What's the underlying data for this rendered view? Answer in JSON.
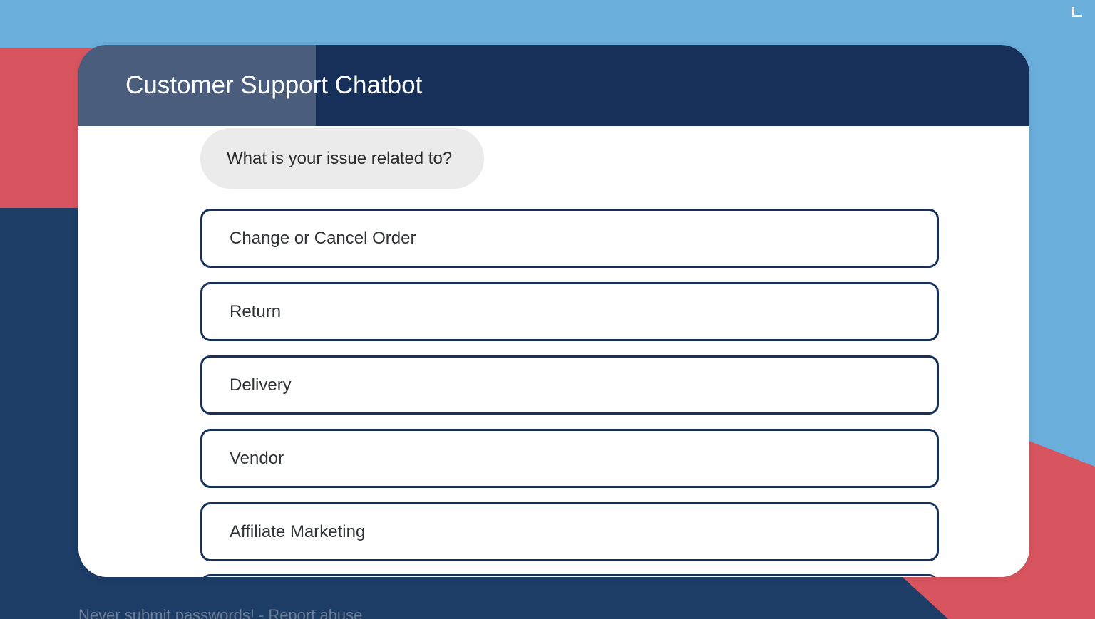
{
  "background": {
    "sky_color": "#6aaedc",
    "navy_color": "#1d3c66",
    "red_color": "#d8545e"
  },
  "header": {
    "title": "Customer Support Chatbot",
    "bar_color": "#17305a",
    "highlight_color": "#4a5d7d"
  },
  "conversation": {
    "bot_message": "What is your issue related to?"
  },
  "options": [
    {
      "label": "Change or Cancel Order"
    },
    {
      "label": "Return"
    },
    {
      "label": "Delivery"
    },
    {
      "label": "Vendor"
    },
    {
      "label": "Affiliate Marketing"
    }
  ],
  "footer": {
    "warning": "Never submit passwords!",
    "separator": "-",
    "report_link": "Report abuse"
  },
  "icons": {
    "corner": "fullscreen-corner-icon"
  }
}
